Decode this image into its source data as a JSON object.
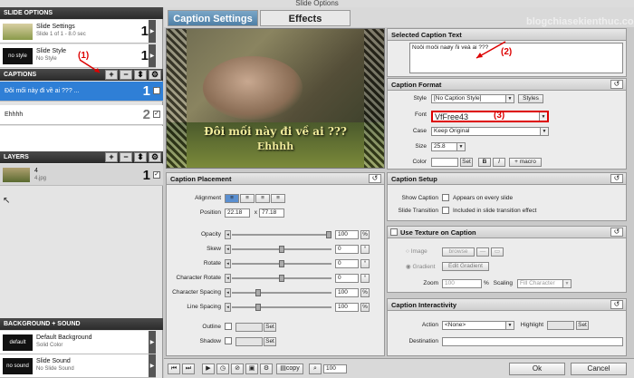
{
  "window": {
    "title": "Slide Options"
  },
  "left": {
    "slide_options_header": "SLIDE OPTIONS",
    "slide_settings": {
      "title": "Slide Settings",
      "sub": "Slide 1 of 1 - 8.0 sec",
      "num": "1"
    },
    "slide_style": {
      "thumb": "no style",
      "title": "Slide Style",
      "sub": "No Style",
      "num": "1"
    },
    "captions_header": "CAPTIONS",
    "tools": {
      "add": "+",
      "remove": "−",
      "updown": "⬍",
      "settings": "⚙"
    },
    "captions": [
      {
        "text": "Đôi mối này đi về ai ??? ...",
        "num": "1"
      },
      {
        "text": "Ehhhh",
        "num": "2"
      }
    ],
    "layers_header": "LAYERS",
    "layer": {
      "title": "4",
      "sub": "4.jpg",
      "num": "1"
    },
    "bg_header": "BACKGROUND + SOUND",
    "bg": {
      "thumb": "default",
      "title": "Default Background",
      "sub": "Solid Color"
    },
    "sound": {
      "thumb": "no sound",
      "title": "Slide Sound",
      "sub": "No Slide Sound"
    }
  },
  "tabs": [
    "Caption Settings",
    "Effects"
  ],
  "watermark": "blogchiasekienthuc.com",
  "preview": {
    "caption1": "Đôi mối này đi về ai ???",
    "caption2": "Ehhhh"
  },
  "annotations": {
    "a1": "(1)",
    "a2": "(2)",
    "a3": "(3)"
  },
  "selected_caption": {
    "header": "Selected Caption Text",
    "value": "Noôi moôi naøy ñi veà ai ???"
  },
  "caption_format": {
    "header": "Caption Format",
    "style_label": "Style",
    "style_value": "[No Caption Style]",
    "styles_btn": "Styles",
    "font_label": "Font",
    "font_value": "VfFree43",
    "case_label": "Case",
    "case_value": "Keep Original",
    "size_label": "Size",
    "size_value": "25.8",
    "color_label": "Color",
    "set_btn": "Set",
    "bold": "B",
    "italic": "I",
    "macro": "+ macro"
  },
  "placement": {
    "header": "Caption Placement",
    "alignment_label": "Alignment",
    "position_label": "Position",
    "pos_x": "22.18",
    "pos_x_sep": "x",
    "pos_y": "77.18",
    "opacity_label": "Opacity",
    "opacity_value": "100",
    "opacity_unit": "%",
    "skew_label": "Skew",
    "skew_value": "0",
    "skew_unit": "°",
    "rotate_label": "Rotate",
    "rotate_value": "0",
    "rotate_unit": "°",
    "charrot_label": "Character Rotate",
    "charrot_value": "0",
    "charrot_unit": "°",
    "charspace_label": "Character Spacing",
    "charspace_value": "100",
    "charspace_unit": "%",
    "linespace_label": "Line Spacing",
    "linespace_value": "100",
    "linespace_unit": "%",
    "outline_label": "Outline",
    "shadow_label": "Shadow",
    "set_btn": "Set"
  },
  "setup": {
    "header": "Caption Setup",
    "show_label": "Show Caption",
    "show_cb": "Appears on every slide",
    "trans_label": "Slide Transition",
    "trans_cb": "Included in slide transition effect"
  },
  "texture": {
    "header": "Use Texture on Caption",
    "image_label": "Image",
    "browse_btn": "browse",
    "gradient_label": "Gradient",
    "edit_gradient_btn": "Edit Gradient",
    "zoom_label": "Zoom",
    "zoom_value": "100",
    "zoom_unit": "%",
    "scaling_label": "Scaling",
    "scaling_value": "Fill Character"
  },
  "interactivity": {
    "header": "Caption Interactivity",
    "action_label": "Action",
    "action_value": "<None>",
    "highlight_label": "Highlight",
    "set_btn": "Set",
    "destination_label": "Destination"
  },
  "bottom": {
    "copy": "copy",
    "zoom": "100",
    "ok": "Ok",
    "cancel": "Cancel"
  },
  "colors": {
    "accent": "#4f7fa6",
    "header_dark": "#2a2a2a",
    "selected": "#2f7fd6",
    "annot": "#dd0000"
  }
}
